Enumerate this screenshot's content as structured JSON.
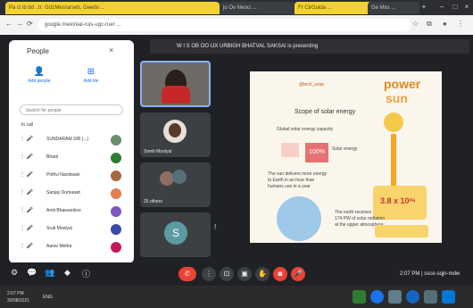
{
  "browser": {
    "tabs": [
      {
        "label": "Pa cl ib bd ..tr: Gd1Mesrarseb, Geedo ..."
      },
      {
        "label": "jo Ov Neoci ..."
      },
      {
        "label": "Fr ClrGuida ..."
      },
      {
        "label": "Ge Mxs ..."
      }
    ],
    "url": "google.meet/eal-ruis-ugc-ruer ..."
  },
  "meeting": {
    "presenting_banner": "W I S OB OO IJX URBIGH BHATVAL SAKSAI is presenting",
    "time_and_code": "2:07 PM  |  ssce-sqjn-mdw",
    "tiles": [
      {
        "name": ""
      },
      {
        "name": "Smriti Moolyal"
      },
      {
        "name": "25 others"
      },
      {
        "name": ""
      }
    ],
    "avatar_letter": "S"
  },
  "people_panel": {
    "title": "People",
    "add_people": "Add people",
    "add_tile": "Add tile",
    "search_placeholder": "Search for people",
    "section_label": "In call",
    "participants": [
      {
        "name": "SUNDARAM SIR (...)",
        "color": "#6b8f6b"
      },
      {
        "name": "Bharti",
        "color": "#2e7d32"
      },
      {
        "name": "Prithvi Nandwani",
        "color": "#a5673f"
      },
      {
        "name": "Sanjay Dumawat",
        "color": "#e67c4f"
      },
      {
        "name": "Amit Bhawanikoo",
        "color": "#7e57c2"
      },
      {
        "name": "Sruti Moolyal",
        "color": "#3949ab"
      },
      {
        "name": "Aarav Mehta",
        "color": "#c2185b"
      }
    ]
  },
  "slide": {
    "brand": "power",
    "brand2": "sun",
    "handle": "@tech_solar",
    "headline": "Scope of solar energy",
    "lines": [
      "Global solar energy capacity",
      "100%",
      "Solar energy",
      "The sun delivers more energy",
      "to Earth in an hour than",
      "humans use in a year",
      "3.8 x 10^26",
      "watts of power",
      "The earth receives",
      "174 PW of solar radiation",
      "at the upper atmosphere"
    ],
    "big_number": "3.8 x 10²⁶"
  },
  "controls": {
    "end_call_icon": "phone-hangup",
    "mic_icon": "microphone",
    "cam_icon": "camera"
  },
  "taskbar": {
    "time": "2:07 PM",
    "date": "30/08/2021",
    "lang": "ENG"
  },
  "colors": {
    "end_call": "#ea4335",
    "accent": "#1a73e8",
    "tab_yellow": "#f2d230"
  }
}
